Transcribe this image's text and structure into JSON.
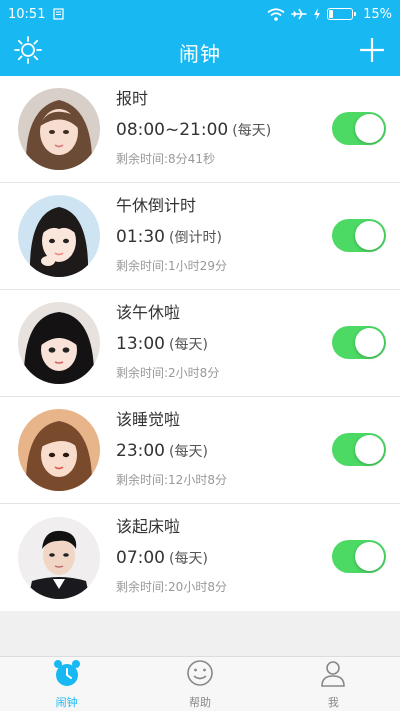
{
  "status_bar": {
    "time": "10:51",
    "battery": "15%",
    "battery_level": 0.15
  },
  "header": {
    "title": "闹钟",
    "left_icon": "settings-sun-icon",
    "right_icon": "add-plus-icon"
  },
  "colors": {
    "brand": "#18b9f2",
    "toggle_on": "#4cd964"
  },
  "alarms": [
    {
      "name": "报时",
      "time": "08:00~21:00",
      "repeat": "(每天)",
      "remain_label": "剩余时间:",
      "remain": "8分41秒",
      "enabled": true
    },
    {
      "name": "午休倒计时",
      "time": "01:30",
      "repeat": "(倒计时)",
      "remain_label": "剩余时间:",
      "remain": "1小时29分",
      "enabled": true
    },
    {
      "name": "该午休啦",
      "time": "13:00",
      "repeat": "(每天)",
      "remain_label": "剩余时间:",
      "remain": "2小时8分",
      "enabled": true
    },
    {
      "name": "该睡觉啦",
      "time": "23:00",
      "repeat": "(每天)",
      "remain_label": "剩余时间:",
      "remain": "12小时8分",
      "enabled": true
    },
    {
      "name": "该起床啦",
      "time": "07:00",
      "repeat": "(每天)",
      "remain_label": "剩余时间:",
      "remain": "20小时8分",
      "enabled": true
    }
  ],
  "tabs": [
    {
      "label": "闹钟",
      "icon": "alarm-clock-icon",
      "active": true
    },
    {
      "label": "帮助",
      "icon": "smiley-icon",
      "active": false
    },
    {
      "label": "我",
      "icon": "person-icon",
      "active": false
    }
  ]
}
